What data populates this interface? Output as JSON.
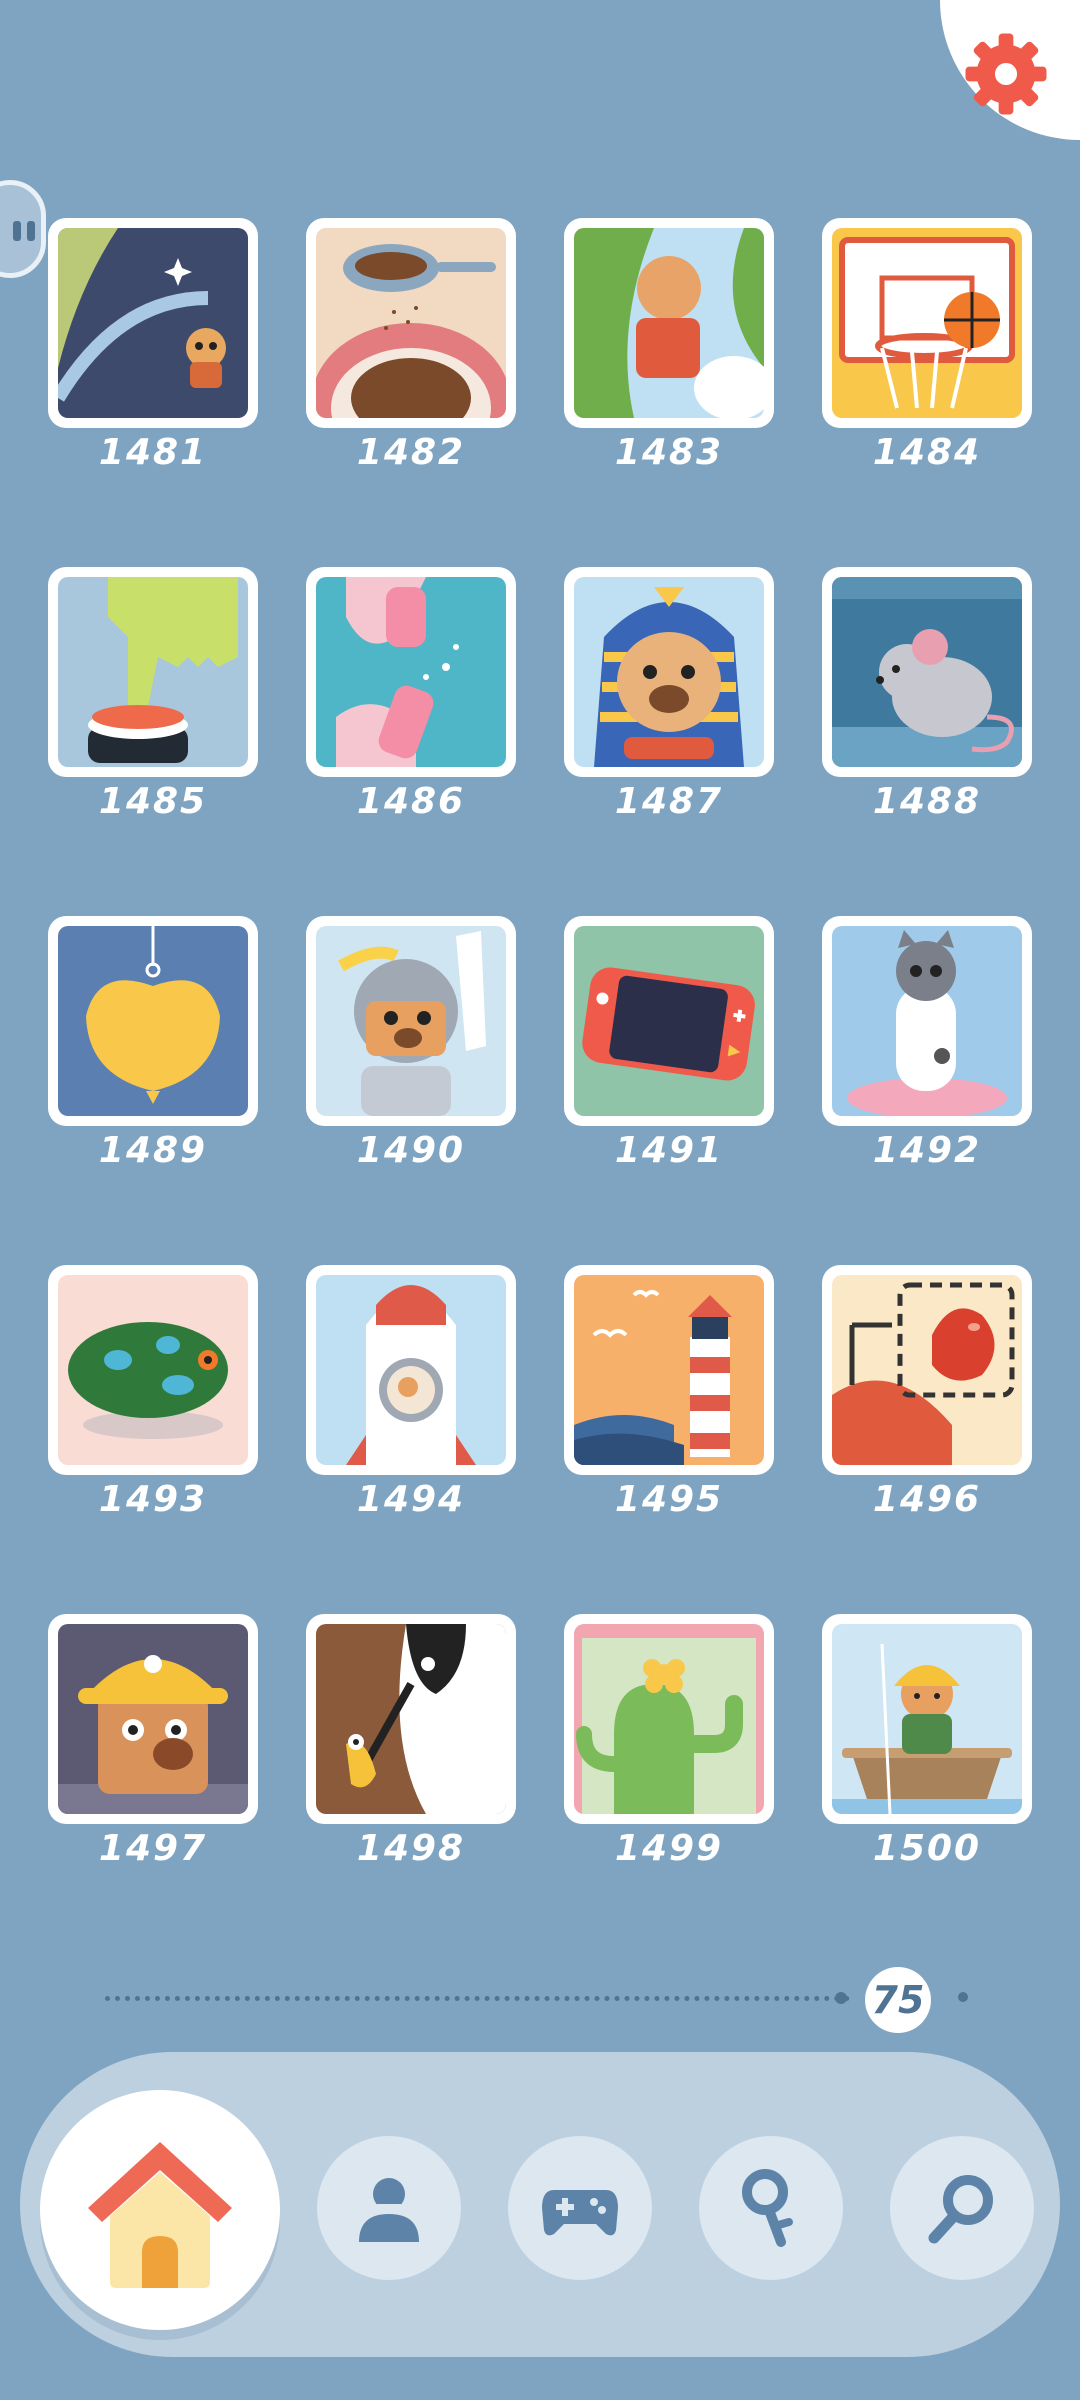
{
  "levels": [
    {
      "number": "1481"
    },
    {
      "number": "1482"
    },
    {
      "number": "1483"
    },
    {
      "number": "1484"
    },
    {
      "number": "1485"
    },
    {
      "number": "1486"
    },
    {
      "number": "1487"
    },
    {
      "number": "1488"
    },
    {
      "number": "1489"
    },
    {
      "number": "1490"
    },
    {
      "number": "1491"
    },
    {
      "number": "1492"
    },
    {
      "number": "1493"
    },
    {
      "number": "1494"
    },
    {
      "number": "1495"
    },
    {
      "number": "1496"
    },
    {
      "number": "1497"
    },
    {
      "number": "1498"
    },
    {
      "number": "1499"
    },
    {
      "number": "1500"
    }
  ],
  "pager": {
    "current_page": "75"
  },
  "colors": {
    "background": "#7fa4c1",
    "accent_red": "#ef5a4a",
    "nav_icon": "#5d84a8"
  },
  "icons": {
    "settings": "gear-icon",
    "home": "home-icon",
    "profile": "user-icon",
    "games": "gamepad-icon",
    "key": "key-icon",
    "search": "search-icon"
  }
}
